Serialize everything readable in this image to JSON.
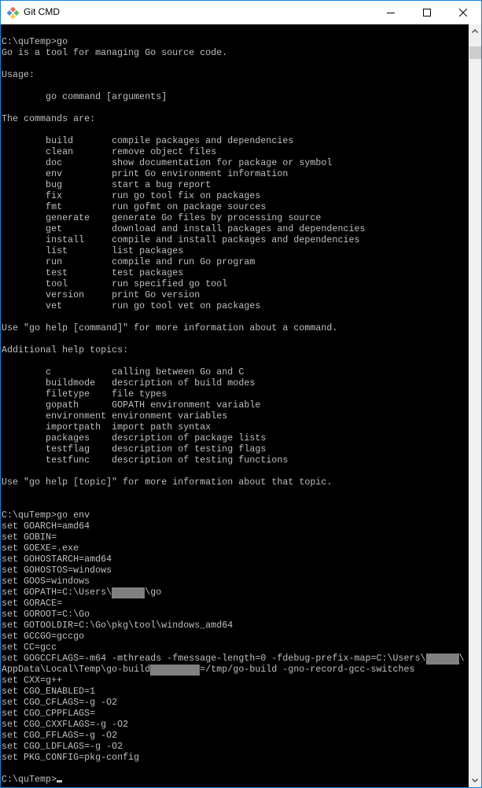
{
  "window": {
    "title": "Git CMD",
    "icon": "git-logo-icon",
    "controls": [
      "minimize-icon",
      "maximize-icon",
      "close-icon"
    ]
  },
  "console": {
    "lines": [
      {
        "text": "C:\\quTemp>go"
      },
      {
        "text": "Go is a tool for managing Go source code."
      },
      {
        "text": ""
      },
      {
        "text": "Usage:"
      },
      {
        "text": ""
      },
      {
        "text": "        go command [arguments]"
      },
      {
        "text": ""
      },
      {
        "text": "The commands are:"
      },
      {
        "text": ""
      },
      {
        "text": "        build       compile packages and dependencies"
      },
      {
        "text": "        clean       remove object files"
      },
      {
        "text": "        doc         show documentation for package or symbol"
      },
      {
        "text": "        env         print Go environment information"
      },
      {
        "text": "        bug         start a bug report"
      },
      {
        "text": "        fix         run go tool fix on packages"
      },
      {
        "text": "        fmt         run gofmt on package sources"
      },
      {
        "text": "        generate    generate Go files by processing source"
      },
      {
        "text": "        get         download and install packages and dependencies"
      },
      {
        "text": "        install     compile and install packages and dependencies"
      },
      {
        "text": "        list        list packages"
      },
      {
        "text": "        run         compile and run Go program"
      },
      {
        "text": "        test        test packages"
      },
      {
        "text": "        tool        run specified go tool"
      },
      {
        "text": "        version     print Go version"
      },
      {
        "text": "        vet         run go tool vet on packages"
      },
      {
        "text": ""
      },
      {
        "text": "Use \"go help [command]\" for more information about a command."
      },
      {
        "text": ""
      },
      {
        "text": "Additional help topics:"
      },
      {
        "text": ""
      },
      {
        "text": "        c           calling between Go and C"
      },
      {
        "text": "        buildmode   description of build modes"
      },
      {
        "text": "        filetype    file types"
      },
      {
        "text": "        gopath      GOPATH environment variable"
      },
      {
        "text": "        environment environment variables"
      },
      {
        "text": "        importpath  import path syntax"
      },
      {
        "text": "        packages    description of package lists"
      },
      {
        "text": "        testflag    description of testing flags"
      },
      {
        "text": "        testfunc    description of testing functions"
      },
      {
        "text": ""
      },
      {
        "text": "Use \"go help [topic]\" for more information about that topic."
      },
      {
        "text": ""
      },
      {
        "text": ""
      },
      {
        "text": "C:\\quTemp>go env"
      },
      {
        "text": "set GOARCH=amd64"
      },
      {
        "text": "set GOBIN="
      },
      {
        "text": "set GOEXE=.exe"
      },
      {
        "text": "set GOHOSTARCH=amd64"
      },
      {
        "text": "set GOHOSTOS=windows"
      },
      {
        "text": "set GOOS=windows"
      },
      {
        "parts": [
          {
            "text": "set GOPATH=C:\\Users\\"
          },
          {
            "redacted": "XXXXXX"
          },
          {
            "text": "\\go"
          }
        ]
      },
      {
        "text": "set GORACE="
      },
      {
        "text": "set GOROOT=C:\\Go"
      },
      {
        "text": "set GOTOOLDIR=C:\\Go\\pkg\\tool\\windows_amd64"
      },
      {
        "text": "set GCCGO=gccgo"
      },
      {
        "text": "set CC=gcc"
      },
      {
        "parts": [
          {
            "text": "set GOGCCFLAGS=-m64 -mthreads -fmessage-length=0 -fdebug-prefix-map=C:\\Users\\"
          },
          {
            "redacted": "XXXXXX"
          },
          {
            "text": "\\"
          }
        ]
      },
      {
        "parts": [
          {
            "text": "AppData\\Local\\Temp\\go-build"
          },
          {
            "redacted": "XXXXXXXXX"
          },
          {
            "text": "=/tmp/go-build -gno-record-gcc-switches"
          }
        ]
      },
      {
        "text": "set CXX=g++"
      },
      {
        "text": "set CGO_ENABLED=1"
      },
      {
        "text": "set CGO_CFLAGS=-g -O2"
      },
      {
        "text": "set CGO_CPPFLAGS="
      },
      {
        "text": "set CGO_CXXFLAGS=-g -O2"
      },
      {
        "text": "set CGO_FFLAGS=-g -O2"
      },
      {
        "text": "set CGO_LDFLAGS=-g -O2"
      },
      {
        "text": "set PKG_CONFIG=pkg-config"
      },
      {
        "text": ""
      },
      {
        "text": "C:\\quTemp>",
        "cursor": true
      }
    ]
  },
  "scrollbar": {
    "position": 0.0
  }
}
